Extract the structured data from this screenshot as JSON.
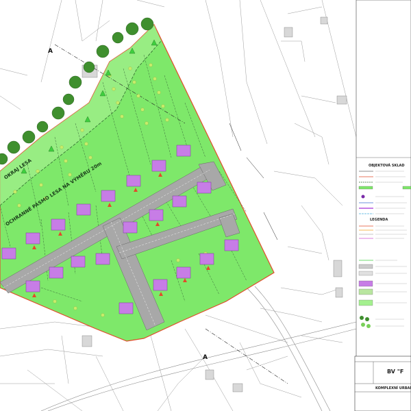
{
  "map": {
    "forest_label": "OKRAJ LESA",
    "buffer_label": "OCHRANNÉ PÁSMO LESA NA VÝMĚRU 20m",
    "section_mark_top": "A",
    "section_mark_bottom": "A"
  },
  "legend": {
    "panel_title_1": "OBJEKTOVÁ SKLAD",
    "panel_title_2": "LEGENDA"
  },
  "title_block": {
    "project_short": "BV \"F",
    "drawing_title": "KOMPLEXNÍ URBANIS"
  },
  "colors": {
    "development_green": "#7ee86a",
    "house_purple": "#c77de6",
    "road_grey": "#a8a8a8",
    "boundary_red": "#e24a2a",
    "tree_green": "#3f8f2e",
    "parcel_line": "#6a6a6a"
  }
}
